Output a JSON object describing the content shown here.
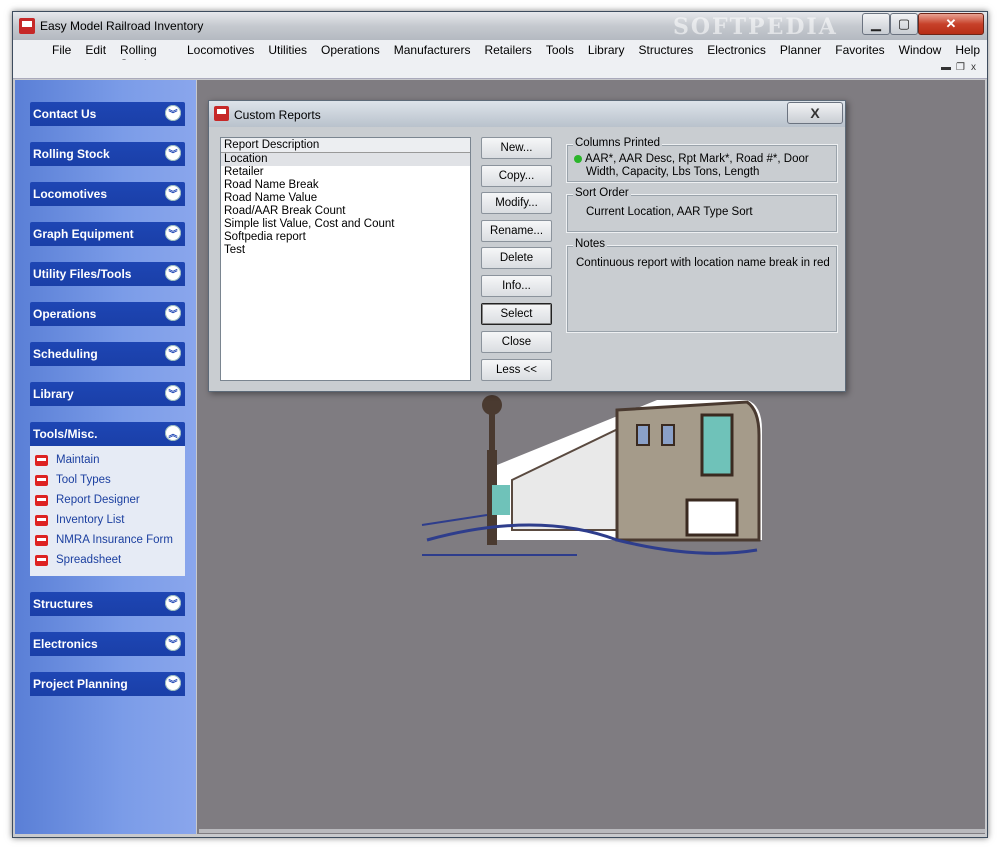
{
  "window": {
    "title": "Easy Model Railroad Inventory",
    "watermark": "SOFTPEDIA",
    "min_label": "▁",
    "max_label": "▢",
    "close_label": "✕"
  },
  "menu": [
    "File",
    "Edit",
    "Rolling Stock",
    "Locomotives",
    "Utilities",
    "Operations",
    "Manufacturers",
    "Retailers",
    "Tools",
    "Library",
    "Structures",
    "Electronics",
    "Planner",
    "Favorites",
    "Window",
    "Help"
  ],
  "mdi_controls": {
    "minimize": "▬",
    "restore": "❐",
    "close": "x"
  },
  "sidebar": {
    "sections": [
      {
        "label": "Contact Us"
      },
      {
        "label": "Rolling Stock"
      },
      {
        "label": "Locomotives"
      },
      {
        "label": "Graph Equipment"
      },
      {
        "label": "Utility Files/Tools"
      },
      {
        "label": "Operations"
      },
      {
        "label": "Scheduling"
      },
      {
        "label": "Library"
      },
      {
        "label": "Tools/Misc."
      },
      {
        "label": "Structures"
      },
      {
        "label": "Electronics"
      },
      {
        "label": "Project Planning"
      }
    ],
    "tools_items": [
      "Maintain",
      "Tool Types",
      "Report Designer",
      "Inventory List",
      "NMRA Insurance Form",
      "Spreadsheet"
    ],
    "chevron_down": "︾",
    "chevron_up": "︽"
  },
  "dialog": {
    "title": "Custom Reports",
    "close_label": "X",
    "list_header": "Report Description",
    "list_items": [
      "Location",
      "Retailer",
      "Road Name Break",
      "Road Name Value",
      "Road/AAR Break Count",
      "Simple list Value, Cost and Count",
      "Softpedia report",
      "Test"
    ],
    "buttons": [
      "New...",
      "Copy...",
      "Modify...",
      "Rename...",
      "Delete",
      "Info...",
      "Select",
      "Close",
      "Less <<"
    ],
    "columns_label": "Columns Printed",
    "columns_line1": "AAR*, AAR Desc, Rpt Mark*, Road #*, Door",
    "columns_line2": "Width, Capacity, Lbs Tons, Length",
    "sort_label": "Sort Order",
    "sort_text": "Current Location,  AAR Type Sort",
    "notes_label": "Notes",
    "notes_text": "Continuous report with location name break in red"
  }
}
